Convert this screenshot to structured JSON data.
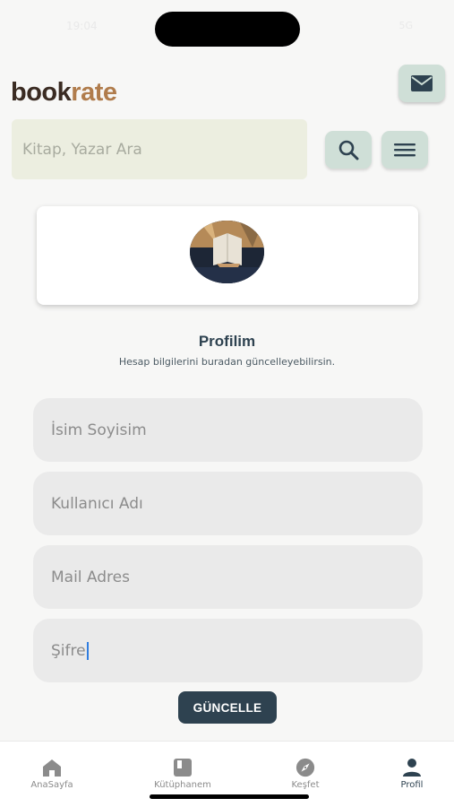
{
  "status": {
    "time": "19:04",
    "right": "5G"
  },
  "header": {
    "logo_part1": "book",
    "logo_part2": "rate"
  },
  "search": {
    "placeholder": "Kitap, Yazar Ara"
  },
  "icons": {
    "mail": "mail-icon",
    "search": "search-icon",
    "menu": "menu-icon"
  },
  "profile": {
    "title": "Profilim",
    "subtitle": "Hesap bilgilerini buradan güncelleyebilirsin."
  },
  "form": {
    "name_placeholder": "İsim Soyisim",
    "username_placeholder": "Kullanıcı Adı",
    "email_placeholder": "Mail Adres",
    "password_placeholder": "Şifre",
    "submit_label": "GÜNCELLE"
  },
  "tabs": [
    {
      "label": "AnaSayfa",
      "icon": "home-icon",
      "active": false
    },
    {
      "label": "Kütüphanem",
      "icon": "book-icon",
      "active": false
    },
    {
      "label": "Keşfet",
      "icon": "compass-icon",
      "active": false
    },
    {
      "label": "Profil",
      "icon": "person-icon",
      "active": true
    }
  ],
  "colors": {
    "accent": "#2e4250",
    "button_bg": "#cfdfd7",
    "logo_book": "#3a2b22",
    "logo_rate": "#b07c4c"
  }
}
